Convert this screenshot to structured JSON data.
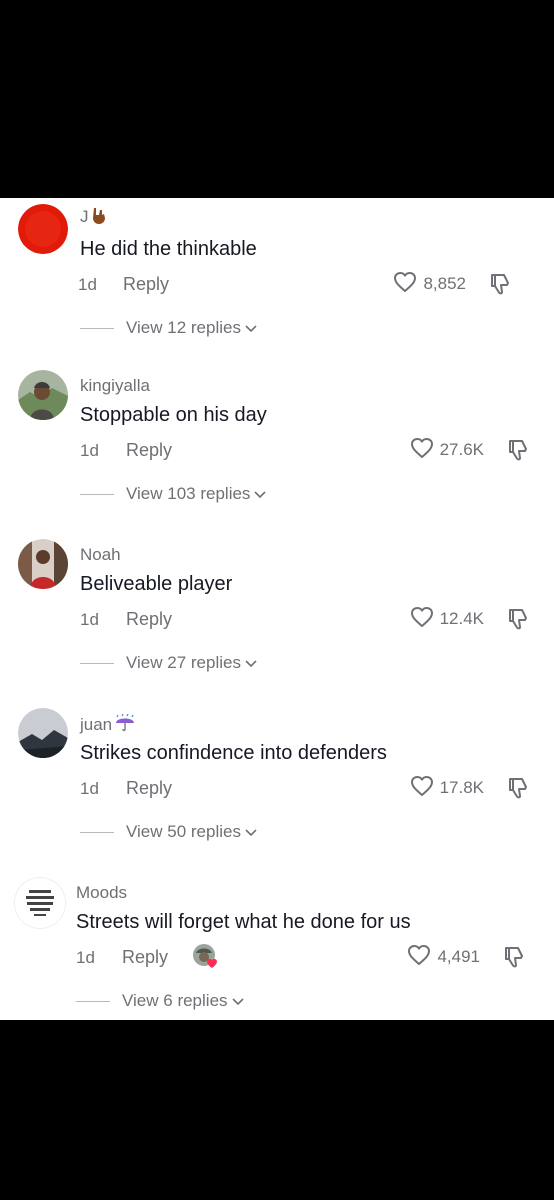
{
  "comments": [
    {
      "username": "J",
      "username_emoji": "rock-hand-emoji",
      "text": "He did the thinkable",
      "age": "1d",
      "reply_label": "Reply",
      "likes": "8,852",
      "view_replies": "View 12 replies",
      "avatar_color": "#e21a0a"
    },
    {
      "username": "kingiyalla",
      "text": "Stoppable on his day",
      "age": "1d",
      "reply_label": "Reply",
      "likes": "27.6K",
      "view_replies": "View 103 replies",
      "avatar_color": "#7d8c6a"
    },
    {
      "username": "Noah",
      "text": "Beliveable player",
      "age": "1d",
      "reply_label": "Reply",
      "likes": "12.4K",
      "view_replies": "View 27 replies",
      "avatar_color": "#8a5a4a"
    },
    {
      "username": "juan",
      "username_emoji": "umbrella-rain-emoji",
      "text": "Strikes confindence into defenders",
      "age": "1d",
      "reply_label": "Reply",
      "likes": "17.8K",
      "view_replies": "View 50 replies",
      "avatar_color": "#5e6470"
    },
    {
      "username": "Moods",
      "text": "Streets will forget what he done for us",
      "age": "1d",
      "reply_label": "Reply",
      "likes": "4,491",
      "view_replies": "View 6 replies",
      "avatar_color": "#ffffff",
      "creator_liked": true
    }
  ],
  "colors": {
    "text_primary": "#161823",
    "text_secondary": "#6f7075",
    "background": "#ffffff",
    "letterbox": "#000000"
  }
}
